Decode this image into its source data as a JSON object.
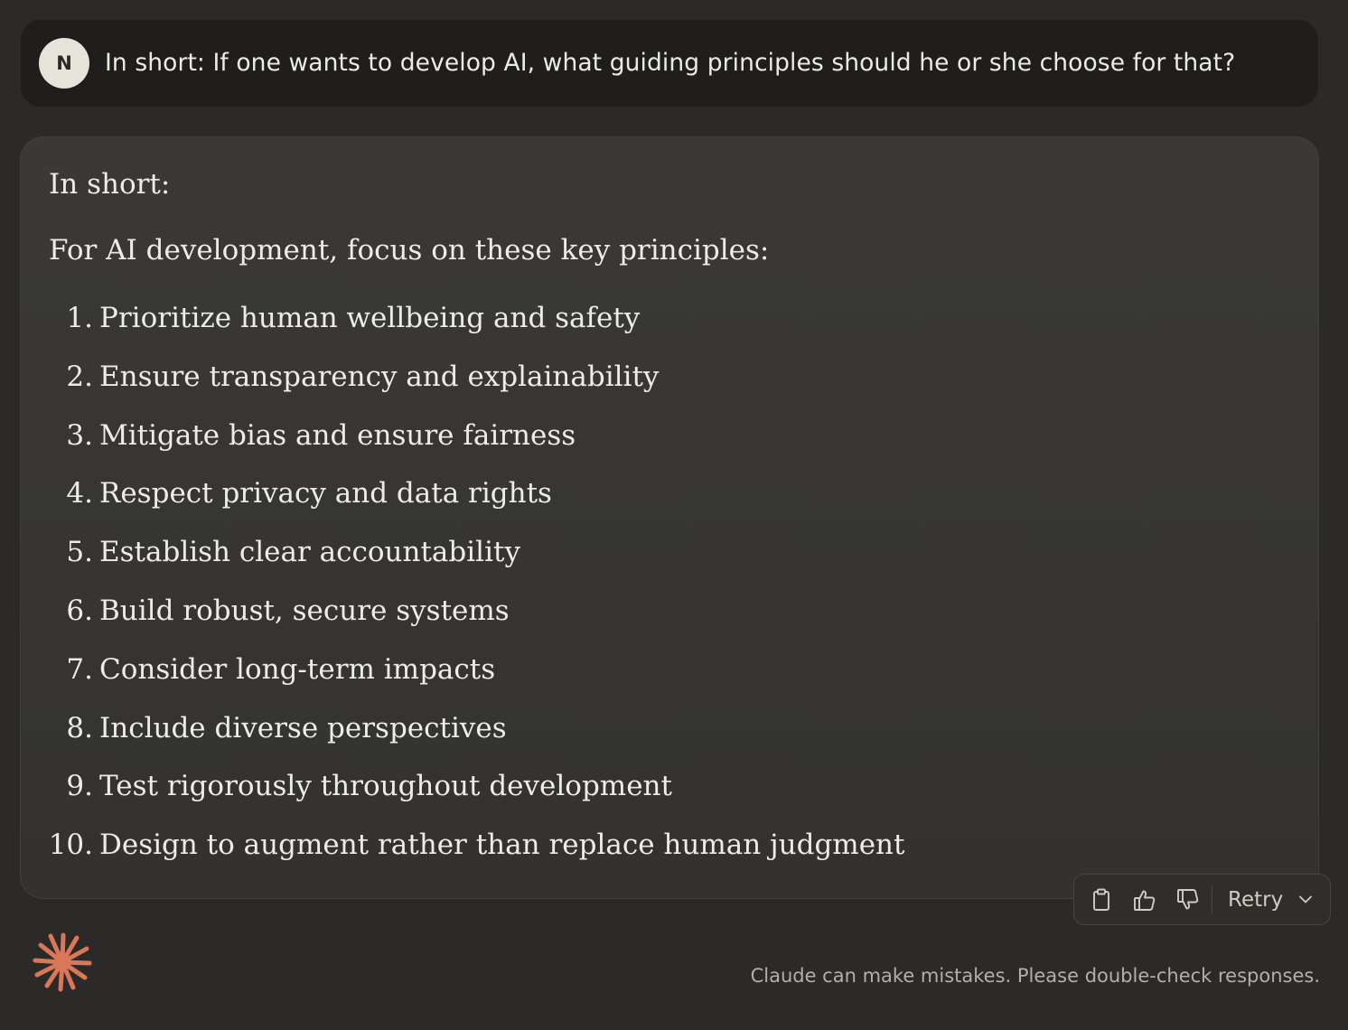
{
  "user_message": {
    "avatar_initial": "N",
    "text": "In short: If one wants to develop AI, what guiding principles should he or she choose for that?"
  },
  "response": {
    "intro": "In short:",
    "lead": "For AI development, focus on these key principles:",
    "principles": [
      {
        "num": "1.",
        "text": "Prioritize human wellbeing and safety"
      },
      {
        "num": "2.",
        "text": "Ensure transparency and explainability"
      },
      {
        "num": "3.",
        "text": "Mitigate bias and ensure fairness"
      },
      {
        "num": "4.",
        "text": "Respect privacy and data rights"
      },
      {
        "num": "5.",
        "text": "Establish clear accountability"
      },
      {
        "num": "6.",
        "text": "Build robust, secure systems"
      },
      {
        "num": "7.",
        "text": "Consider long-term impacts"
      },
      {
        "num": "8.",
        "text": "Include diverse perspectives"
      },
      {
        "num": "9.",
        "text": "Test rigorously throughout development"
      },
      {
        "num": "10.",
        "text": "Design to augment rather than replace human judgment"
      }
    ]
  },
  "actions": {
    "icons": [
      "clipboard-icon",
      "thumbs-up-icon",
      "thumbs-down-icon",
      "chevron-down-icon"
    ],
    "retry_label": "Retry"
  },
  "footer": {
    "logo_icon": "claude-asterisk-icon",
    "disclaimer": "Claude can make mistakes. Please double-check responses."
  },
  "colors": {
    "background": "#2b2a28",
    "user_bubble": "#1f1e1c",
    "response_card": "#383734",
    "brand_accent": "#d97757"
  }
}
